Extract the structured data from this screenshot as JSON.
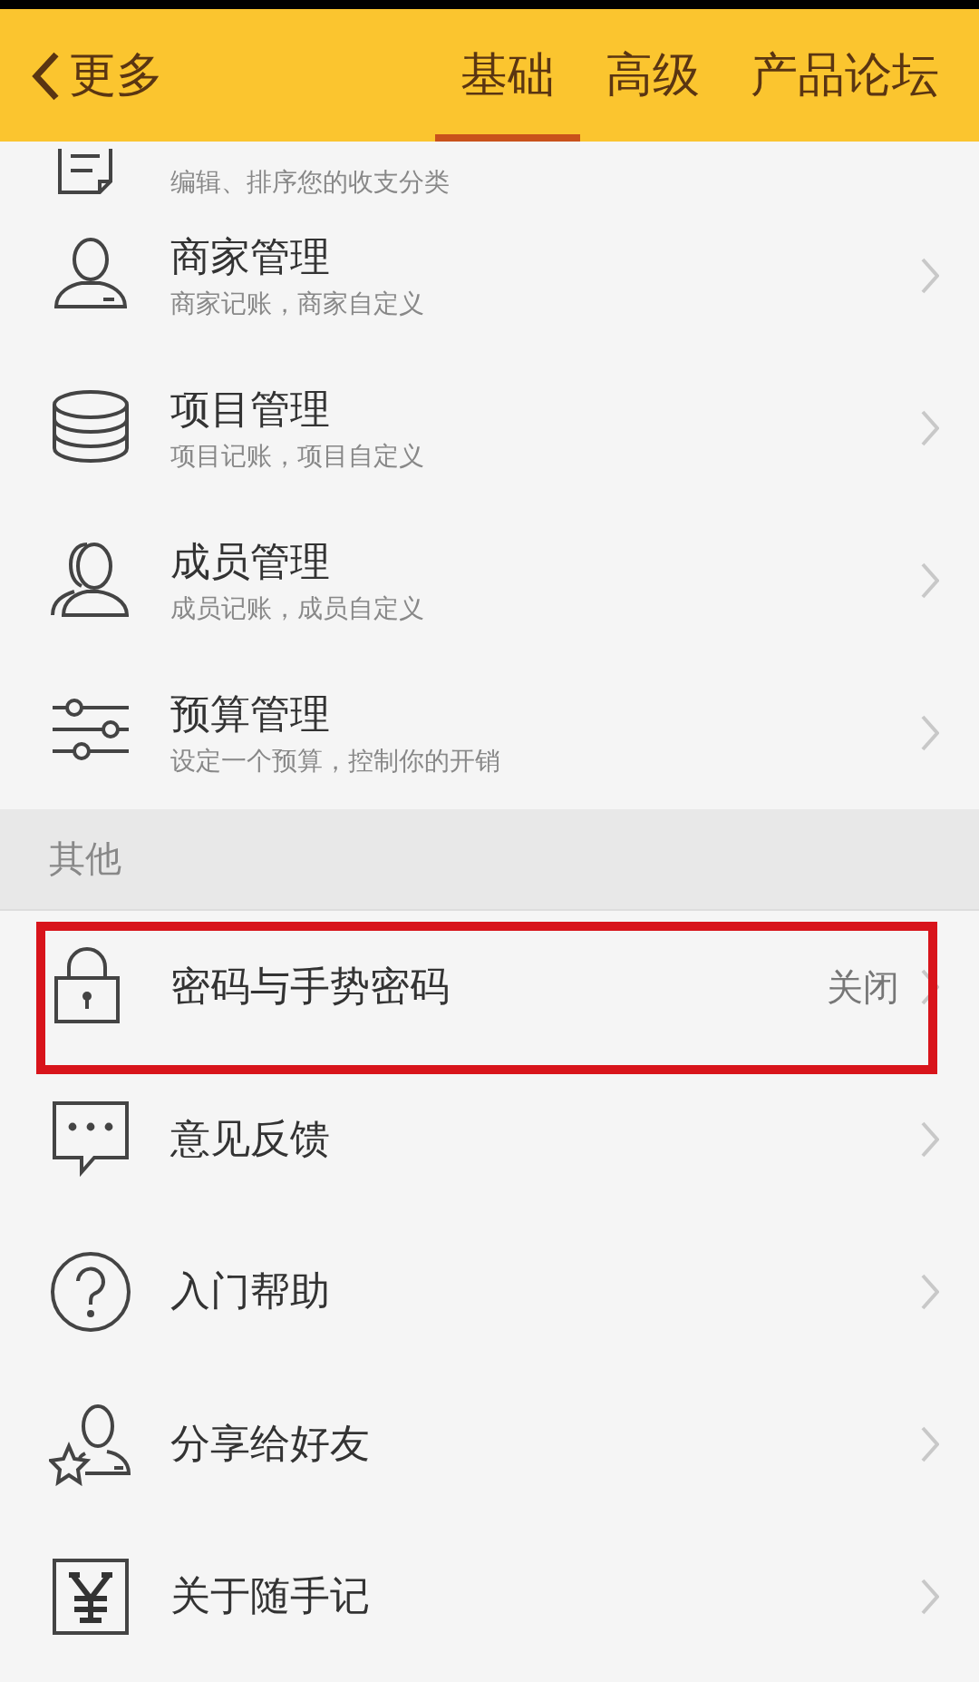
{
  "header": {
    "back_label": "更多",
    "tabs": [
      {
        "label": "基础",
        "selected": true
      },
      {
        "label": "高级",
        "selected": false
      },
      {
        "label": "产品论坛",
        "selected": false
      }
    ]
  },
  "sections": [
    {
      "items": [
        {
          "subtitle": "编辑、排序您的收支分类",
          "highlighted": false
        },
        {
          "title": "商家管理",
          "subtitle": "商家记账，商家自定义",
          "highlighted": false
        },
        {
          "title": "项目管理",
          "subtitle": "项目记账，项目自定义",
          "highlighted": false
        },
        {
          "title": "成员管理",
          "subtitle": "成员记账，成员自定义",
          "highlighted": false
        },
        {
          "title": "预算管理",
          "subtitle": "设定一个预算，控制你的开销",
          "highlighted": false
        }
      ]
    },
    {
      "title": "其他",
      "items": [
        {
          "title": "密码与手势密码",
          "value": "关闭",
          "highlighted": true
        },
        {
          "title": "意见反馈",
          "highlighted": false
        },
        {
          "title": "入门帮助",
          "highlighted": false
        },
        {
          "title": "分享给好友",
          "highlighted": false
        },
        {
          "title": "关于随手记",
          "highlighted": false
        }
      ]
    }
  ]
}
